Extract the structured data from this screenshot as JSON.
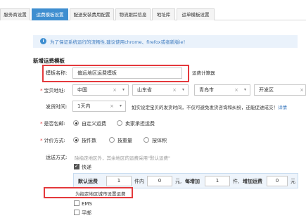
{
  "tabs": [
    {
      "label": "服务商设置",
      "active": false
    },
    {
      "label": "运费模板设置",
      "active": true
    },
    {
      "label": "配送安装费用配置",
      "active": false
    },
    {
      "label": "物流跟踪信息",
      "active": false
    },
    {
      "label": "地址库",
      "active": false
    },
    {
      "label": "运单模板设置",
      "active": false
    }
  ],
  "notice": {
    "icon": "info-icon",
    "text": "为了保证系统运行的流畅性,建议使用chrome、firefox或者新版ie！"
  },
  "section_title": "新增运费模板",
  "form": {
    "template_name_label": "模板名称:",
    "template_name_value": "偏远地区运费模板",
    "calculator_link": "运费计算器",
    "address_label": "宝贝地址:",
    "address": {
      "country": "中国",
      "province": "山东省",
      "city": "青岛市",
      "district": "开发区",
      "clear": "×",
      "caret": "▾"
    },
    "ship_time_label": "发货时间:",
    "ship_time_value": "1天内",
    "ship_time_hint": "如实设定宝贝的发货时间，不仅可避免发货咨询和纠纷，还能促进成交！",
    "ship_time_link": "详情",
    "free_label": "是否包邮:",
    "free_options": [
      {
        "label": "自定义运费",
        "selected": true
      },
      {
        "label": "卖家承担运费",
        "selected": false
      }
    ],
    "pricing_label": "计价方式:",
    "pricing_options": [
      {
        "label": "按件数",
        "selected": true
      },
      {
        "label": "按重量",
        "selected": false
      },
      {
        "label": "按体积",
        "selected": false
      }
    ],
    "shipping_label": "运送方式:",
    "shipping_hint": "除指定地区外，其余地区的运费采用\"默认运费\"",
    "express": {
      "label": "快递",
      "checked": true
    },
    "fee": {
      "default_label": "默认运费",
      "first_qty": "1",
      "first_unit": "件内",
      "first_fee": "0",
      "yuan": "元,",
      "each_add_label": "每增加",
      "add_qty": "1",
      "add_unit": "件,",
      "add_fee_label": "增加运费",
      "add_fee": "0",
      "yuan2": "元"
    },
    "region_link": "为指定地区城市设置运费",
    "ems": {
      "label": "EMS",
      "checked": false
    },
    "post": {
      "label": "平邮",
      "checked": false
    }
  }
}
